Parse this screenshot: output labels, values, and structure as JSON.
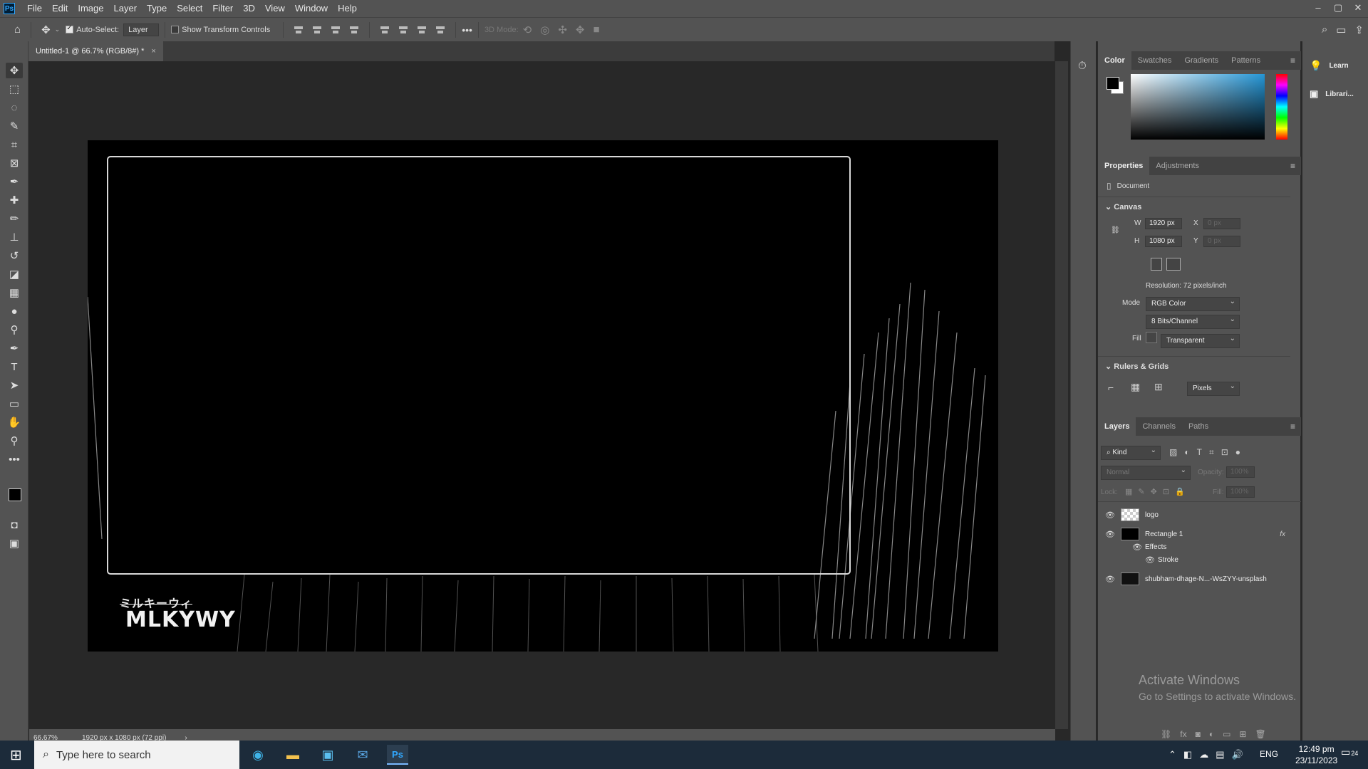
{
  "menubar": {
    "logo": "Ps",
    "items": [
      "File",
      "Edit",
      "Image",
      "Layer",
      "Type",
      "Select",
      "Filter",
      "3D",
      "View",
      "Window",
      "Help"
    ]
  },
  "window_controls": {
    "minimize": "–",
    "restore": "▢",
    "close": "✕"
  },
  "options": {
    "auto_select_label": "Auto-Select:",
    "auto_select_checked": true,
    "auto_select_target": "Layer",
    "show_transform_label": "Show Transform Controls",
    "mode_3d_label": "3D Mode:",
    "more": "•••"
  },
  "document_tab": {
    "title": "Untitled-1 @ 66.7% (RGB/8#) *",
    "close": "×"
  },
  "canvas": {
    "logo_jp": "ミルキーウィ",
    "logo_en": "MLKYWY"
  },
  "status": {
    "zoom": "66.67%",
    "doc_info": "1920 px x 1080 px (72 ppi)",
    "arrow": "›"
  },
  "color_panel": {
    "tabs": [
      "Color",
      "Swatches",
      "Gradients",
      "Patterns"
    ],
    "active_tab": "Color",
    "field_hue_color": "#2596d6"
  },
  "properties": {
    "tabs": [
      "Properties",
      "Adjustments"
    ],
    "doc_label": "Document",
    "canvas_section": "Canvas",
    "w_label": "W",
    "w_value": "1920 px",
    "h_label": "H",
    "h_value": "1080 px",
    "x_label": "X",
    "x_value": "0 px",
    "y_label": "Y",
    "y_value": "0 px",
    "resolution": "Resolution: 72 pixels/inch",
    "mode_label": "Mode",
    "mode_value": "RGB Color",
    "bits_value": "8 Bits/Channel",
    "fill_label": "Fill",
    "fill_value": "Transparent",
    "rulers_section": "Rulers & Grids",
    "units_value": "Pixels"
  },
  "layers": {
    "tabs": [
      "Layers",
      "Channels",
      "Paths"
    ],
    "kind_label": "Kind",
    "blend_mode": "Normal",
    "opacity_label": "Opacity:",
    "opacity_value": "100%",
    "lock_label": "Lock:",
    "fill_label": "Fill:",
    "fill_value": "100%",
    "rows": [
      {
        "name": "logo"
      },
      {
        "name": "Rectangle 1",
        "fx": "fx"
      },
      {
        "name": "Effects"
      },
      {
        "name": "Stroke"
      },
      {
        "name": "shubham-dhage-N...-WsZYY-unsplash"
      }
    ]
  },
  "right_panel": {
    "learn": "Learn",
    "libraries": "Librari..."
  },
  "watermark": {
    "title": "Activate Windows",
    "subtitle": "Go to Settings to activate Windows."
  },
  "taskbar": {
    "search_placeholder": "Type here to search",
    "lang": "ENG",
    "time": "12:49 pm",
    "date": "23/11/2023",
    "notif_count": "24"
  }
}
